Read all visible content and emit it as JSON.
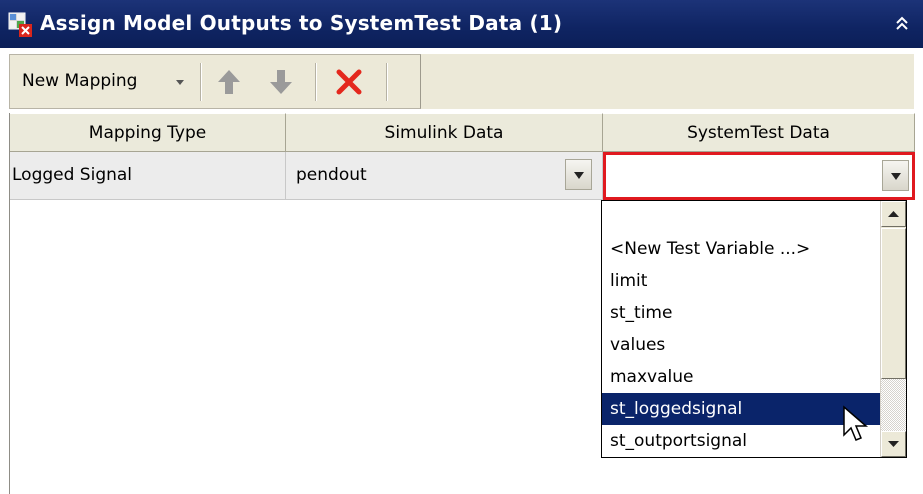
{
  "window": {
    "title": "Assign Model Outputs to SystemTest Data (1)",
    "icon": "mapping-table-icon",
    "collapse_icon": "double-chevron-up-icon"
  },
  "toolbar": {
    "new_mapping_label": "New Mapping",
    "move_up_icon": "arrow-up-icon",
    "move_down_icon": "arrow-down-icon",
    "delete_icon": "red-x-delete-icon"
  },
  "grid": {
    "columns": [
      "Mapping Type",
      "Simulink Data",
      "SystemTest Data"
    ],
    "rows": [
      {
        "mapping_type": "Logged Signal",
        "simulink_data": "pendout",
        "systemtest_data": ""
      }
    ]
  },
  "dropdown": {
    "options": [
      "",
      "<New Test Variable ...>",
      "limit",
      "st_time",
      "values",
      "maxvalue",
      "st_loggedsignal",
      "st_outportsignal"
    ],
    "highlighted": "st_loggedsignal"
  },
  "colors": {
    "titlebar": "#0f2462",
    "selection": "#0a246a",
    "focus_border": "#e0191f",
    "delete_red": "#e4281d"
  }
}
